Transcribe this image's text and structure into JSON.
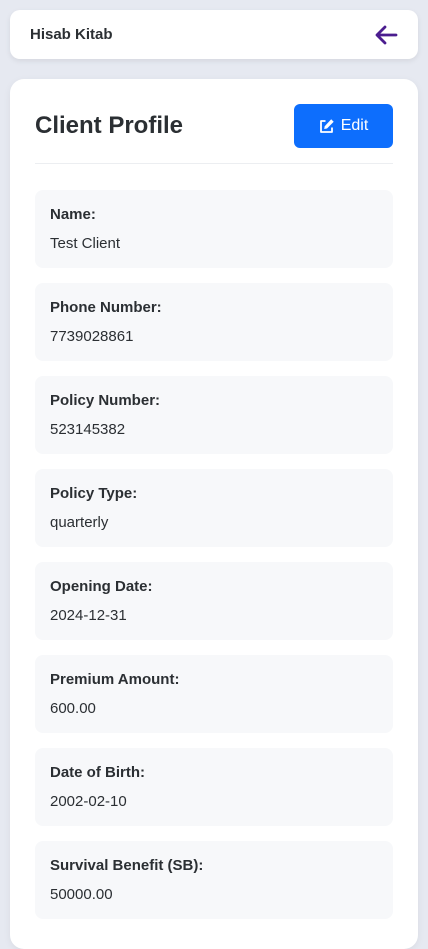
{
  "app": {
    "brand": "Hisab Kitab",
    "accent_color": "#4b1d8f",
    "primary_button_color": "#0d6efd"
  },
  "header": {
    "back_icon": "arrow-left-icon"
  },
  "profile": {
    "title": "Client Profile",
    "edit_label": "Edit",
    "edit_icon": "edit-square-icon",
    "fields": [
      {
        "label": "Name:",
        "value": "Test Client"
      },
      {
        "label": "Phone Number:",
        "value": "7739028861"
      },
      {
        "label": "Policy Number:",
        "value": "523145382"
      },
      {
        "label": "Policy Type:",
        "value": "quarterly"
      },
      {
        "label": "Opening Date:",
        "value": "2024-12-31"
      },
      {
        "label": "Premium Amount:",
        "value": "600.00"
      },
      {
        "label": "Date of Birth:",
        "value": "2002-02-10"
      },
      {
        "label": "Survival Benefit (SB):",
        "value": "50000.00"
      }
    ]
  }
}
